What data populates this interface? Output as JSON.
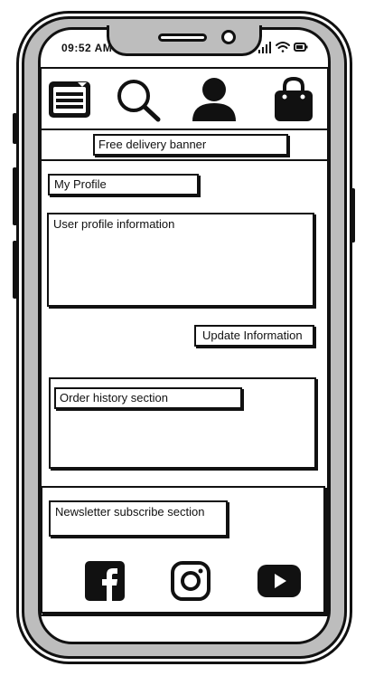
{
  "status_bar": {
    "time": "09:52 AM",
    "icons": [
      "signal-icon",
      "wifi-icon",
      "battery-icon"
    ]
  },
  "top_nav": {
    "items": [
      {
        "name": "menu-icon"
      },
      {
        "name": "search-icon"
      },
      {
        "name": "profile-icon"
      },
      {
        "name": "shopping-bag-icon"
      }
    ]
  },
  "banner": {
    "label": "Free delivery banner"
  },
  "profile": {
    "title": "My Profile",
    "info_label": "User profile information",
    "update_button": "Update Information"
  },
  "orders": {
    "label": "Order history section"
  },
  "newsletter": {
    "label": "Newsletter subscribe section"
  },
  "social": {
    "icons": [
      "facebook-icon",
      "instagram-icon",
      "youtube-icon"
    ]
  }
}
